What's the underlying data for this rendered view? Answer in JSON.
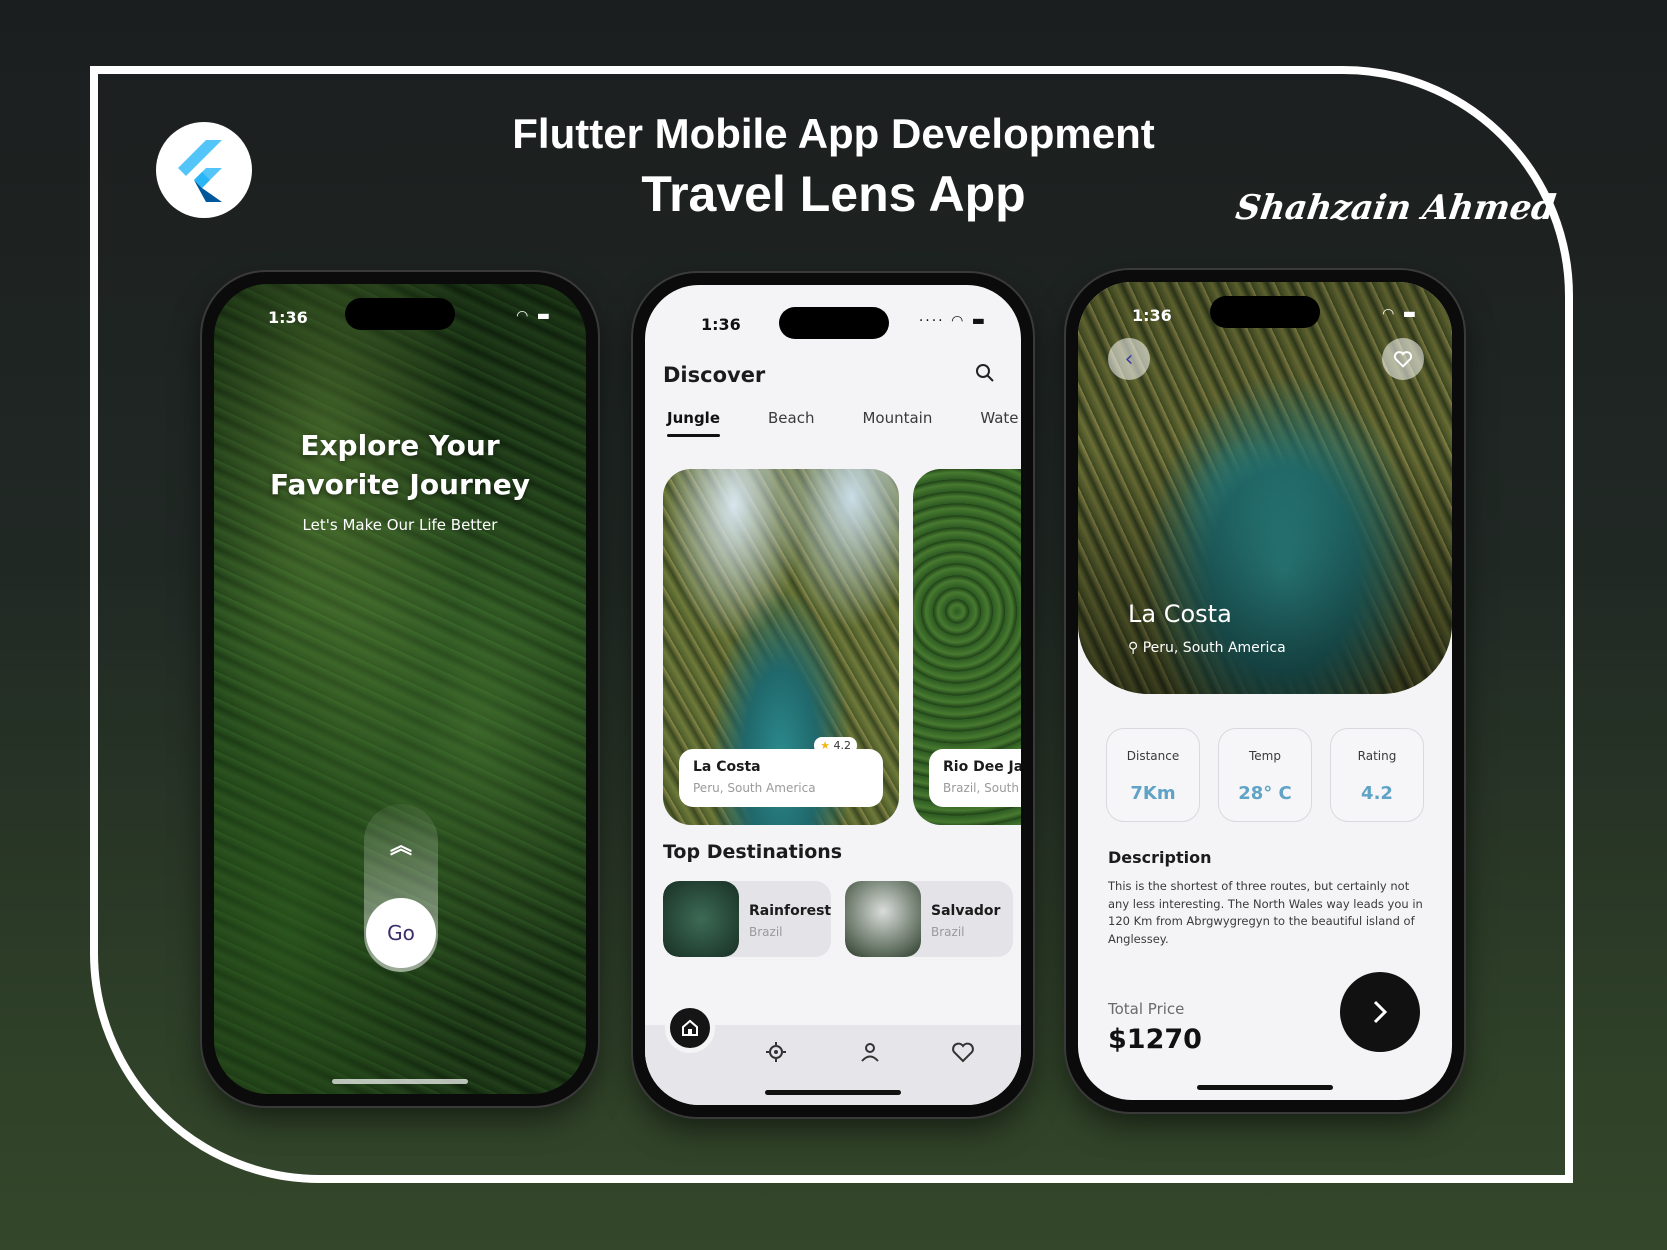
{
  "header": {
    "title_line1": "Flutter Mobile App Development",
    "title_line2": "Travel Lens App",
    "signature": "Shahzain Ahmed",
    "logo_icon": "flutter-logo-icon"
  },
  "phone1": {
    "status_time": "1:36",
    "hero_title_line1": "Explore Your",
    "hero_title_line2": "Favorite Journey",
    "hero_subtitle": "Let's Make Our Life Better",
    "go_label": "Go",
    "swipe_icon": "double-chevron-up-icon"
  },
  "phone2": {
    "status_time": "1:36",
    "title": "Discover",
    "tabs": [
      {
        "label": "Jungle",
        "active": true
      },
      {
        "label": "Beach",
        "active": false
      },
      {
        "label": "Mountain",
        "active": false
      },
      {
        "label": "Wate",
        "active": false
      }
    ],
    "cards": [
      {
        "name": "La Costa",
        "location": "Peru, South America",
        "rating": "4.2"
      },
      {
        "name": "Rio Dee Ja",
        "location": "Brazil, South"
      }
    ],
    "section_title": "Top Destinations",
    "destinations": [
      {
        "name": "Rainforest",
        "location": "Brazil"
      },
      {
        "name": "Salvador",
        "location": "Brazil"
      }
    ],
    "nav_icons": [
      "home-icon",
      "location-icon",
      "profile-icon",
      "heart-icon"
    ]
  },
  "phone3": {
    "status_time": "1:36",
    "place_name": "La Costa",
    "place_location": "Peru, South America",
    "stats": [
      {
        "label": "Distance",
        "value": "7Km"
      },
      {
        "label": "Temp",
        "value": "28° C"
      },
      {
        "label": "Rating",
        "value": "4.2"
      }
    ],
    "description_title": "Description",
    "description_text": "This is the shortest of three routes, but certainly not any less interesting. The North Wales way leads you in 120 Km from Abrgwygregyn to the beautiful island of Anglessey.",
    "price_label": "Total Price",
    "price_value": "$1270"
  },
  "colors": {
    "accent_blue": "#5fa3c6",
    "dark": "#111111",
    "star": "#f3b51b"
  }
}
